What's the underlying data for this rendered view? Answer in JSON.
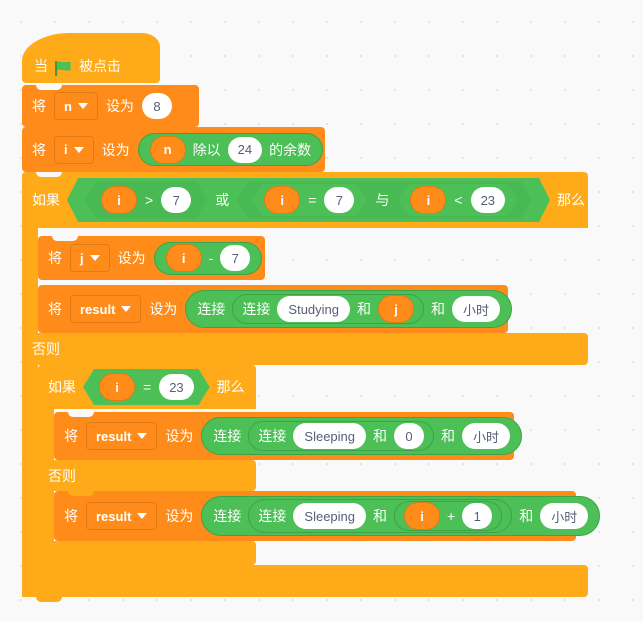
{
  "canvas": {
    "background_color": "#f9f9f9",
    "grid_dot_color": "#e4e4e4"
  },
  "palette": {
    "events_color": "#ffab19",
    "control_color": "#ffab19",
    "variables_color": "#ff8c1a",
    "operators_color": "#4cbf56",
    "input_text_color": "#575e75"
  },
  "script": {
    "hat": {
      "prefix": "当",
      "icon": "green-flag-icon",
      "suffix": "被点击"
    },
    "set_n": {
      "set_label": "将",
      "variable": "n",
      "to_label": "设为",
      "value": "8"
    },
    "set_i": {
      "set_label": "将",
      "variable": "i",
      "to_label": "设为",
      "operator": {
        "left": "n",
        "op_label": "除以",
        "right": "24",
        "tail_label": "的余数"
      }
    },
    "outer_if": {
      "if_label": "如果",
      "then_label": "那么",
      "else_label": "否则",
      "condition": {
        "or_label": "或",
        "and_label": "与",
        "left": {
          "var": "i",
          "op": ">",
          "value": "7"
        },
        "and_left": {
          "var": "i",
          "op": "=",
          "value": "7"
        },
        "and_right": {
          "var": "i",
          "op": "<",
          "value": "23"
        }
      }
    },
    "set_j": {
      "set_label": "将",
      "variable": "j",
      "to_label": "设为",
      "operator": {
        "left": "i",
        "op": "-",
        "right": "7"
      }
    },
    "set_result_studying": {
      "set_label": "将",
      "variable": "result",
      "to_label": "设为",
      "join_label": "连接",
      "inner_join_label": "连接",
      "and_label_1": "和",
      "and_label_2": "和",
      "text1": "Studying",
      "value2": "j",
      "text3": "小时"
    },
    "inner_if": {
      "if_label": "如果",
      "then_label": "那么",
      "else_label": "否则",
      "condition": {
        "var": "i",
        "op": "=",
        "value": "23"
      }
    },
    "set_result_sleeping_0": {
      "set_label": "将",
      "variable": "result",
      "to_label": "设为",
      "join_label": "连接",
      "inner_join_label": "连接",
      "and_label_1": "和",
      "and_label_2": "和",
      "text1": "Sleeping",
      "value2": "0",
      "text3": "小时"
    },
    "set_result_sleeping_i1": {
      "set_label": "将",
      "variable": "result",
      "to_label": "设为",
      "join_label": "连接",
      "inner_join_label": "连接",
      "and_label_1": "和",
      "and_label_2": "和",
      "text1": "Sleeping",
      "operator": {
        "left": "i",
        "op": "+",
        "right": "1"
      },
      "text3": "小时"
    }
  }
}
